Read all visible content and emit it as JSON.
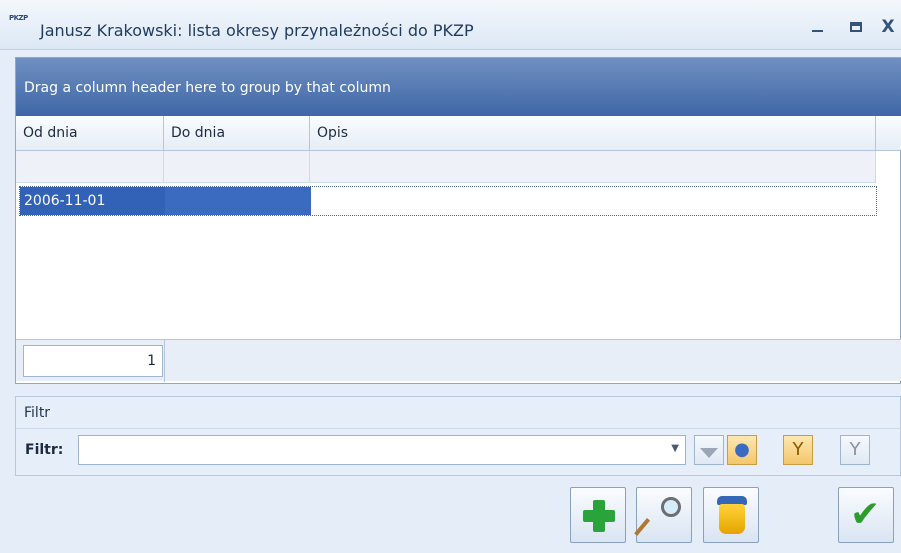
{
  "window": {
    "icon_tag": "PKZP",
    "title": "Janusz Krakowski: lista okresy przynależności do PKZP"
  },
  "grid": {
    "group_hint": "Drag a column header here to group by that column",
    "columns": [
      "Od dnia",
      "Do dnia",
      "Opis"
    ],
    "rows": [
      {
        "od_dnia": "2006-11-01",
        "do_dnia": "",
        "opis": ""
      }
    ],
    "record_count": "1"
  },
  "filter": {
    "group_title": "Filtr",
    "label": "Filtr:",
    "value": ""
  },
  "colors": {
    "group_bar": "#3f66a6",
    "selection": "#3262b8",
    "accent_add": "#29a33a",
    "accent_ok": "#2a9d2a"
  }
}
